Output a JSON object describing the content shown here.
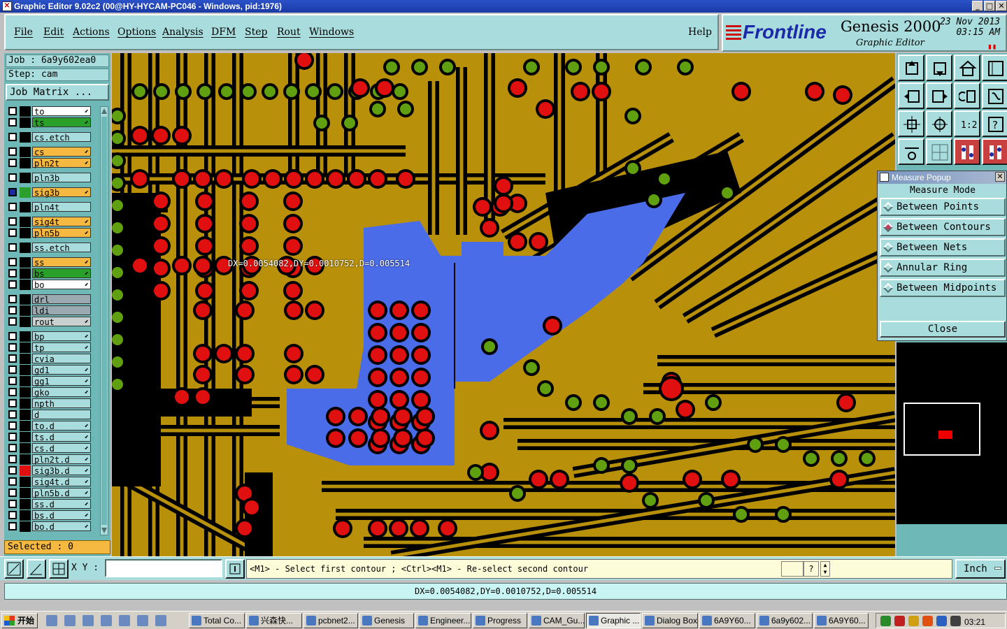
{
  "window": {
    "title": "Graphic Editor 9.02c2 (00@HY-HYCAM-PC046 - Windows, pid:1976)"
  },
  "menu": [
    {
      "label": "File",
      "name": "menu-file"
    },
    {
      "label": "Edit",
      "name": "menu-edit"
    },
    {
      "label": "Actions",
      "name": "menu-actions"
    },
    {
      "label": "Options",
      "name": "menu-options"
    },
    {
      "label": "Analysis",
      "name": "menu-analysis"
    },
    {
      "label": "DFM",
      "name": "menu-dfm"
    },
    {
      "label": "Step",
      "name": "menu-step"
    },
    {
      "label": "Rout",
      "name": "menu-rout"
    },
    {
      "label": "Windows",
      "name": "menu-windows"
    }
  ],
  "help_label": "Help",
  "brand": {
    "logo": "Frontline",
    "product": "Genesis 2000",
    "subtitle": "Graphic Editor",
    "date": "23 Nov 2013",
    "time": "03:15 AM"
  },
  "job": {
    "label": "Job : 6a9y602ea0",
    "step": "Step: cam",
    "matrix_button": "Job Matrix ..."
  },
  "layers": [
    {
      "name": "to",
      "color": "#ffffff",
      "swatch": "#000000",
      "edit": true
    },
    {
      "name": "ts",
      "color": "#2aa02a",
      "swatch": "#000000",
      "edit": true
    },
    {
      "name": "cs.etch",
      "color": "#a9dcdc",
      "swatch": "#000000",
      "edit": false
    },
    {
      "name": "cs",
      "color": "#f5b840",
      "swatch": "#000000",
      "edit": true
    },
    {
      "name": "pln2t",
      "color": "#f5b840",
      "swatch": "#000000",
      "edit": true
    },
    {
      "name": "pln3b",
      "color": "#a9dcdc",
      "swatch": "#000000",
      "edit": false
    },
    {
      "name": "sig3b",
      "color": "#f5b840",
      "swatch": "#2aa02a",
      "edit": true,
      "active": true
    },
    {
      "name": "pln4t",
      "color": "#a9dcdc",
      "swatch": "#000000",
      "edit": false
    },
    {
      "name": "sig4t",
      "color": "#f5b840",
      "swatch": "#000000",
      "edit": true
    },
    {
      "name": "pln5b",
      "color": "#f5b840",
      "swatch": "#000000",
      "edit": true
    },
    {
      "name": "ss.etch",
      "color": "#a9dcdc",
      "swatch": "#000000",
      "edit": false
    },
    {
      "name": "ss",
      "color": "#f5b840",
      "swatch": "#000000",
      "edit": true
    },
    {
      "name": "bs",
      "color": "#2aa02a",
      "swatch": "#000000",
      "edit": true
    },
    {
      "name": "bo",
      "color": "#ffffff",
      "swatch": "#000000",
      "edit": true
    },
    {
      "name": "drl",
      "color": "#9aaab0",
      "swatch": "#000000",
      "edit": false
    },
    {
      "name": "ldi",
      "color": "#9aaab0",
      "swatch": "#000000",
      "edit": false
    },
    {
      "name": "rout",
      "color": "#c8d0d0",
      "swatch": "#000000",
      "edit": true
    },
    {
      "name": "bp",
      "color": "#a9dcdc",
      "swatch": "#000000",
      "edit": true
    },
    {
      "name": "tp",
      "color": "#a9dcdc",
      "swatch": "#000000",
      "edit": true
    },
    {
      "name": "cvia",
      "color": "#a9dcdc",
      "swatch": "#000000",
      "edit": false
    },
    {
      "name": "gd1",
      "color": "#a9dcdc",
      "swatch": "#000000",
      "edit": true
    },
    {
      "name": "gg1",
      "color": "#a9dcdc",
      "swatch": "#000000",
      "edit": true
    },
    {
      "name": "gko",
      "color": "#a9dcdc",
      "swatch": "#000000",
      "edit": true
    },
    {
      "name": "npth",
      "color": "#a9dcdc",
      "swatch": "#000000",
      "edit": false
    },
    {
      "name": "d",
      "color": "#a9dcdc",
      "swatch": "#000000",
      "edit": false
    },
    {
      "name": "to.d",
      "color": "#a9dcdc",
      "swatch": "#000000",
      "edit": true
    },
    {
      "name": "ts.d",
      "color": "#a9dcdc",
      "swatch": "#000000",
      "edit": true
    },
    {
      "name": "cs.d",
      "color": "#a9dcdc",
      "swatch": "#000000",
      "edit": true
    },
    {
      "name": "pln2t.d",
      "color": "#a9dcdc",
      "swatch": "#000000",
      "edit": true
    },
    {
      "name": "sig3b.d",
      "color": "#a9dcdc",
      "swatch": "#e01010",
      "edit": true
    },
    {
      "name": "sig4t.d",
      "color": "#a9dcdc",
      "swatch": "#000000",
      "edit": true
    },
    {
      "name": "pln5b.d",
      "color": "#a9dcdc",
      "swatch": "#000000",
      "edit": true
    },
    {
      "name": "ss.d",
      "color": "#a9dcdc",
      "swatch": "#000000",
      "edit": true
    },
    {
      "name": "bs.d",
      "color": "#a9dcdc",
      "swatch": "#000000",
      "edit": true
    },
    {
      "name": "bo.d",
      "color": "#a9dcdc",
      "swatch": "#000000",
      "edit": true
    }
  ],
  "selected": "Selected : 0",
  "canvas": {
    "measure_text": "DX=0.0054082,DY=0.0010752,D=0.005514",
    "colors": {
      "copper": "#b8900a",
      "trace": "#000000",
      "pad": "#e01010",
      "pad_ring": "#60a010",
      "plane": "#4a6ce8"
    }
  },
  "measure_popup": {
    "title": "Measure Popup",
    "heading": "Measure Mode",
    "options": [
      {
        "label": "Between Points",
        "selected": false
      },
      {
        "label": "Between Contours",
        "selected": true
      },
      {
        "label": "Between Nets",
        "selected": false
      },
      {
        "label": "Annular Ring",
        "selected": false
      },
      {
        "label": "Between Midpoints",
        "selected": false
      }
    ],
    "close": "Close"
  },
  "cmd": {
    "xy_label": "X Y :",
    "xy_value": "",
    "prompt": "<M1> - Select first contour ; <Ctrl><M1> - Re-select second contour",
    "units": "Inch"
  },
  "status": "DX=0.0054082,DY=0.0010752,D=0.005514",
  "taskbar": {
    "start": "开始",
    "tasks": [
      "Total Co...",
      "兴森快...",
      "pcbnet2...",
      "Genesis",
      "Engineer...",
      "Progress",
      "CAM_Gu...",
      "Graphic ...",
      "Dialog Box",
      "6A9Y60...",
      "6a9y602...",
      "6A9Y60..."
    ],
    "active_index": 7,
    "clock": "03:21"
  }
}
